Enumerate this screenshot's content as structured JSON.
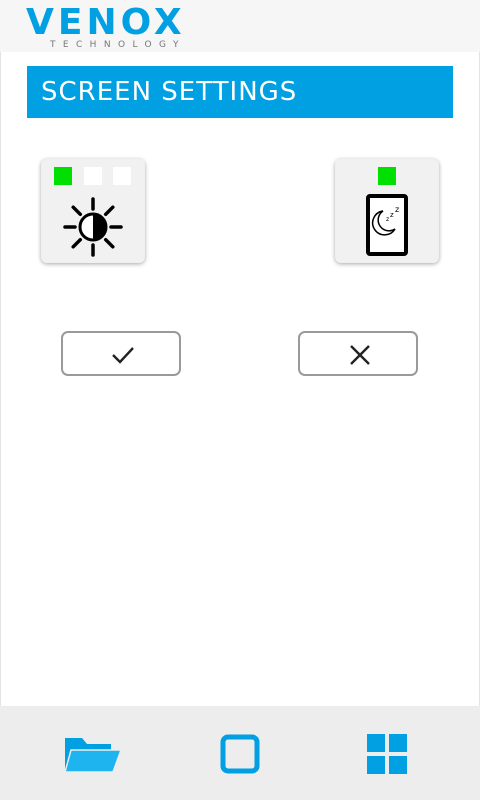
{
  "brand": {
    "name": "VENOX",
    "tagline": "TECHNOLOGY",
    "color": "#00a0e3"
  },
  "page": {
    "title": "SCREEN SETTINGS"
  },
  "brightness": {
    "icon": "brightness-icon",
    "levels_total": 3,
    "level": 1,
    "indicator_on_color": "#00e000"
  },
  "sleep": {
    "icon": "screen-sleep-icon",
    "enabled": true
  },
  "actions": {
    "confirm_icon": "checkmark-icon",
    "cancel_icon": "close-icon"
  },
  "navbar": {
    "items": [
      {
        "icon": "folder-icon"
      },
      {
        "icon": "square-icon"
      },
      {
        "icon": "grid-icon"
      }
    ]
  }
}
